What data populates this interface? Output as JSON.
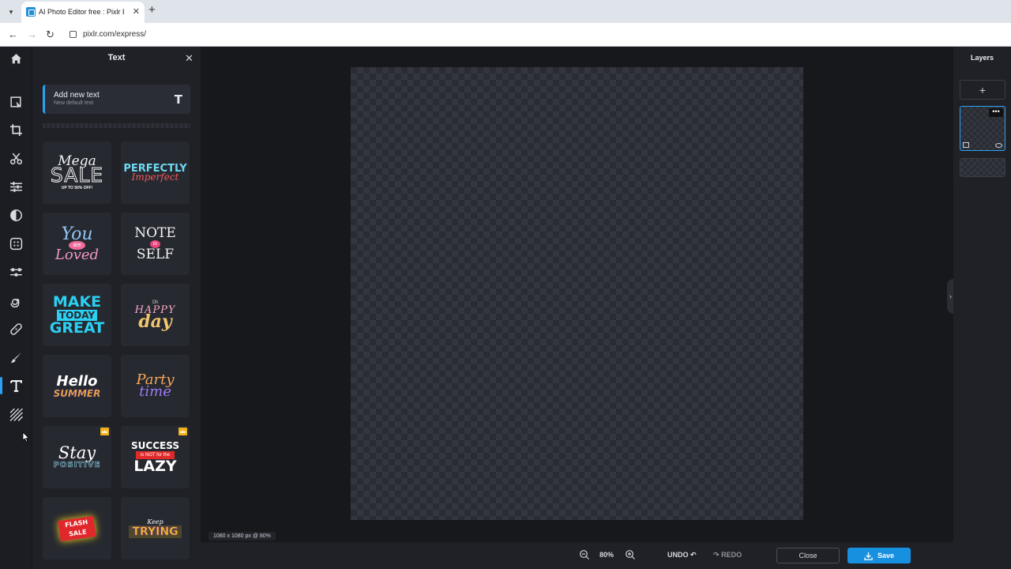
{
  "browser": {
    "tab_title": "AI Photo Editor free : Pixlr Expre",
    "tab_close": "✕",
    "new_tab": "+",
    "url": "pixlr.com/express/"
  },
  "icons": {
    "home": "home-icon",
    "arrange": "arrange-icon",
    "crop": "crop-icon",
    "cutout": "scissors-icon",
    "adjust": "sliders-icon",
    "filter": "contrast-icon",
    "effect": "effect-icon",
    "liquify": "liquify-icon",
    "retouch": "swirl-icon",
    "heal": "bandage-icon",
    "draw": "brush-icon",
    "text": "text-icon",
    "elements": "stripes-icon"
  },
  "panel": {
    "title": "Text",
    "close": "✕",
    "add_text_title": "Add new text",
    "add_text_sub": "New default text",
    "add_text_icon": "T"
  },
  "text_presets": [
    {
      "lines": [
        "Mega",
        "SALE",
        "UP TO 50% OFF!"
      ]
    },
    {
      "lines": [
        "PERFECTLY",
        "Imperfect"
      ]
    },
    {
      "lines": [
        "You",
        "are",
        "Loved"
      ]
    },
    {
      "lines": [
        "NOTE",
        "to",
        "SELF"
      ]
    },
    {
      "lines": [
        "MAKE",
        "TODAY",
        "GREAT"
      ]
    },
    {
      "lines": [
        "Oh",
        "HAPPY",
        "day"
      ]
    },
    {
      "lines": [
        "Hello",
        "SUMMER"
      ]
    },
    {
      "lines": [
        "Party",
        "time"
      ]
    },
    {
      "lines": [
        "Stay",
        "POSITIVE"
      ],
      "premium": true
    },
    {
      "lines": [
        "SUCCESS",
        "is NOT for the",
        "LAZY"
      ],
      "premium": true
    },
    {
      "lines": [
        "FLASH",
        "SALE"
      ]
    },
    {
      "lines": [
        "Keep",
        "TRYING"
      ]
    }
  ],
  "canvas": {
    "dims_label": "1080 x 1080 px @ 80%"
  },
  "bottom": {
    "zoom": "80%",
    "undo": "UNDO",
    "redo": "REDO",
    "close": "Close",
    "save": "Save"
  },
  "layers": {
    "title": "Layers",
    "add": "+",
    "more": "•••"
  },
  "colors": {
    "accent": "#2aa1f3",
    "save": "#1790e0",
    "premium": "#f2b01e"
  }
}
